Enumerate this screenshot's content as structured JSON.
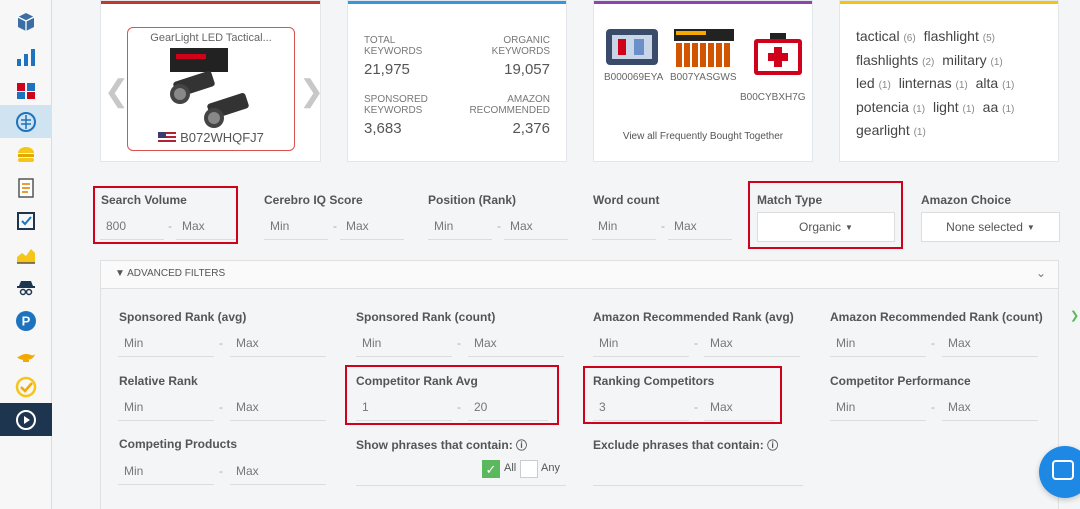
{
  "sidebar": {
    "items": [
      {
        "icon": "cube-icon"
      },
      {
        "icon": "bar-chart-icon"
      },
      {
        "icon": "puzzle-icon"
      },
      {
        "icon": "brain-icon",
        "active": true
      },
      {
        "icon": "burger-icon"
      },
      {
        "icon": "document-icon"
      },
      {
        "icon": "checklist-icon"
      },
      {
        "icon": "area-chart-icon"
      },
      {
        "icon": "spy-icon"
      },
      {
        "icon": "parking-icon"
      },
      {
        "icon": "genie-lamp-icon"
      },
      {
        "icon": "check-circle-icon"
      },
      {
        "icon": "play-icon",
        "dark": true
      }
    ]
  },
  "product_card": {
    "title": "GearLight LED Tactical...",
    "asin": "B072WHQFJ7"
  },
  "keywords_card": {
    "total_label": "TOTAL KEYWORDS",
    "total_value": "21,975",
    "organic_label": "ORGANIC KEYWORDS",
    "organic_value": "19,057",
    "sponsored_label": "SPONSORED KEYWORDS",
    "sponsored_value": "3,683",
    "amazon_label": "AMAZON RECOMMENDED",
    "amazon_value": "2,376"
  },
  "fbt_card": {
    "asins": [
      "B000069EYA",
      "B007YASGWS",
      "B00CYBXH7G"
    ],
    "link": "View all Frequently Bought Together"
  },
  "word_cloud": [
    {
      "word": "tactical",
      "count": "(6)"
    },
    {
      "word": "flashlight",
      "count": "(5)"
    },
    {
      "word": "flashlights",
      "count": "(2)"
    },
    {
      "word": "military",
      "count": "(1)"
    },
    {
      "word": "led",
      "count": "(1)"
    },
    {
      "word": "linternas",
      "count": "(1)"
    },
    {
      "word": "alta",
      "count": "(1)"
    },
    {
      "word": "potencia",
      "count": "(1)"
    },
    {
      "word": "light",
      "count": "(1)"
    },
    {
      "word": "aa",
      "count": "(1)"
    },
    {
      "word": "gearlight",
      "count": "(1)"
    }
  ],
  "filters": {
    "search_volume": {
      "label": "Search Volume",
      "min": "800",
      "max": "Max"
    },
    "cerebro_iq": {
      "label": "Cerebro IQ Score",
      "min": "Min",
      "max": "Max"
    },
    "position": {
      "label": "Position (Rank)",
      "min": "Min",
      "max": "Max"
    },
    "word_count": {
      "label": "Word count",
      "min": "Min",
      "max": "Max"
    },
    "match_type": {
      "label": "Match Type",
      "value": "Organic"
    },
    "amazon_choice": {
      "label": "Amazon Choice",
      "value": "None selected"
    },
    "dash": "-"
  },
  "advanced": {
    "title": "ADVANCED FILTERS",
    "sponsored_rank_avg": {
      "label": "Sponsored Rank (avg)",
      "min": "Min",
      "max": "Max"
    },
    "sponsored_rank_count": {
      "label": "Sponsored Rank (count)",
      "min": "Min",
      "max": "Max"
    },
    "amazon_rec_rank_avg": {
      "label": "Amazon Recommended Rank (avg)",
      "min": "Min",
      "max": "Max"
    },
    "amazon_rec_rank_count": {
      "label": "Amazon Recommended Rank (count)",
      "min": "Min",
      "max": "Max"
    },
    "relative_rank": {
      "label": "Relative Rank",
      "min": "Min",
      "max": "Max"
    },
    "competitor_rank_avg": {
      "label": "Competitor Rank Avg",
      "min": "1",
      "max": "20"
    },
    "ranking_competitors": {
      "label": "Ranking Competitors",
      "min": "3",
      "max": "Max"
    },
    "competitor_performance": {
      "label": "Competitor Performance",
      "min": "Min",
      "max": "Max"
    },
    "competing_products": {
      "label": "Competing Products",
      "min": "Min",
      "max": "Max"
    },
    "show_phrases": {
      "label": "Show phrases that contain:",
      "all": "All",
      "any": "Any"
    },
    "exclude_phrases": {
      "label": "Exclude phrases that contain:"
    }
  },
  "colors": {
    "highlight": "#d0021b",
    "card1_top": "#c0392b",
    "card2_top": "#3498db",
    "card3_top": "#8e44ad",
    "card4_top": "#f1c40f"
  }
}
